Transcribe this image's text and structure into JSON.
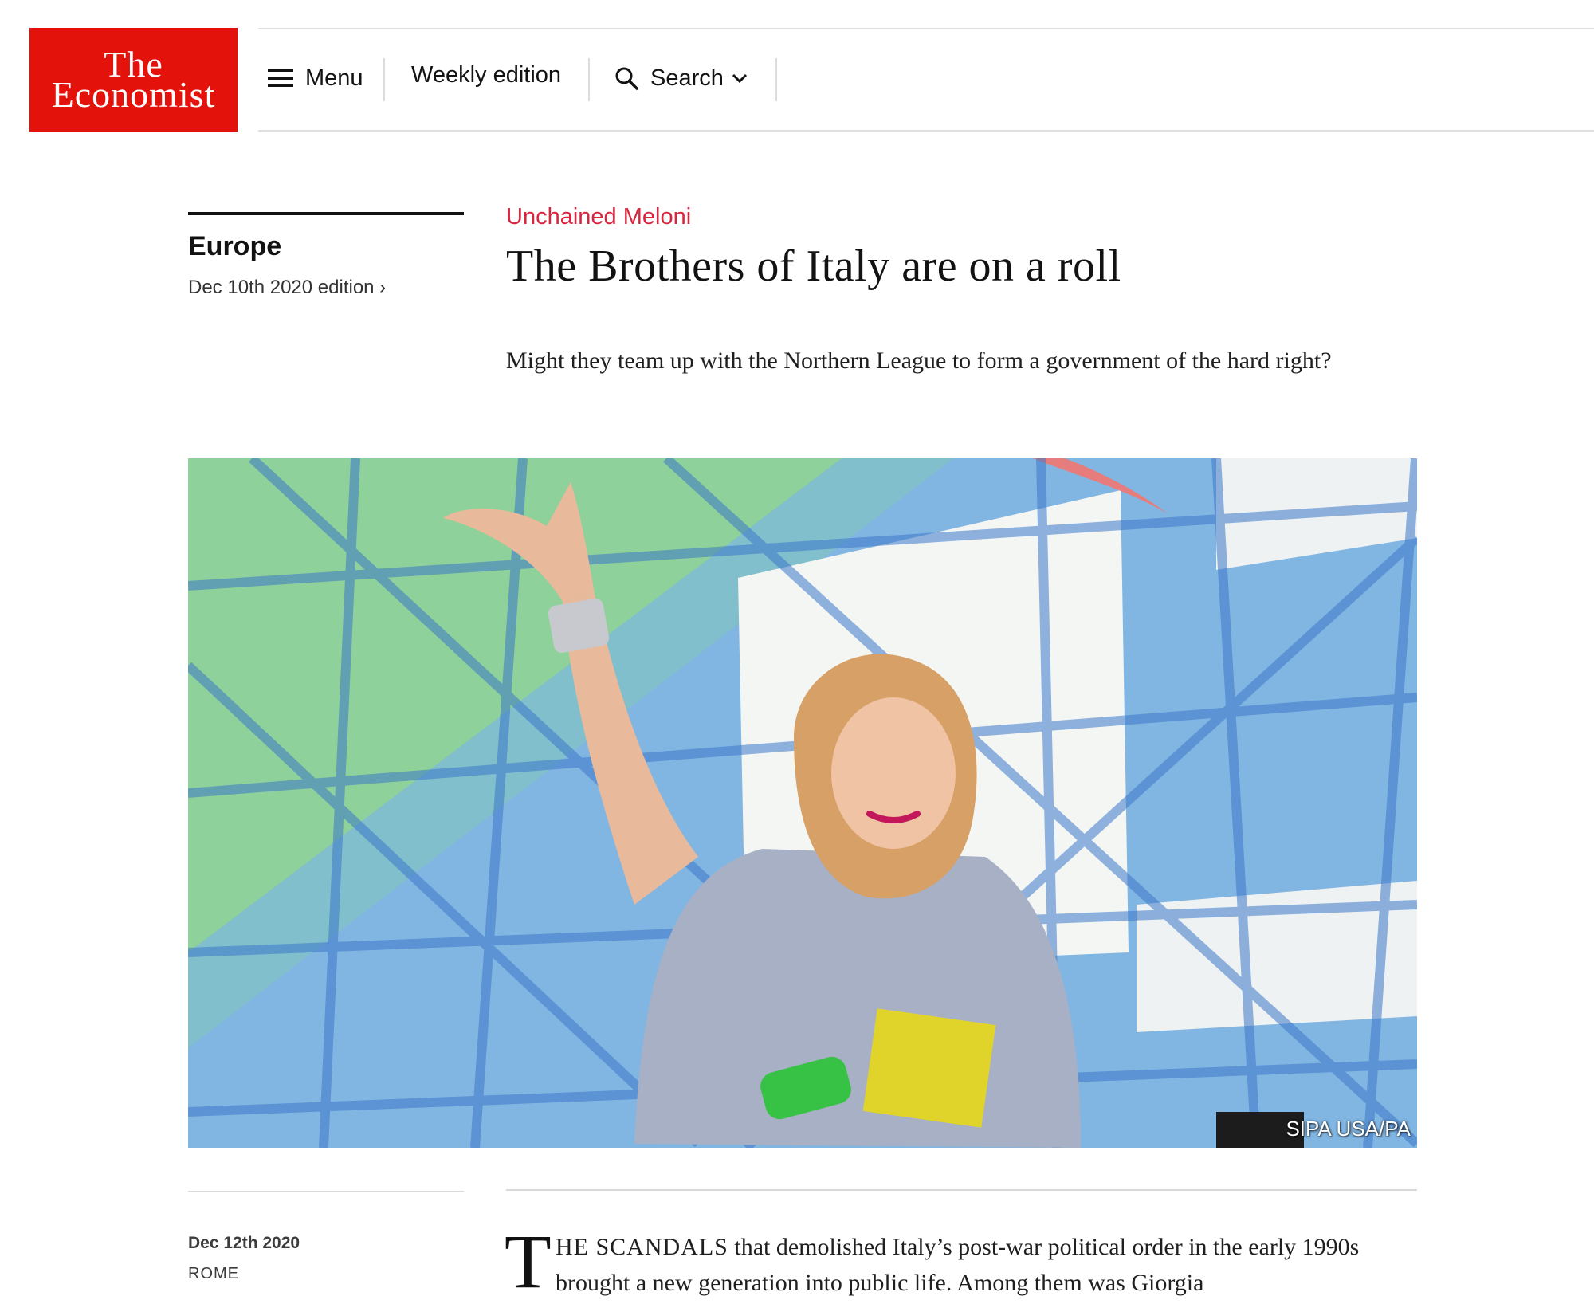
{
  "header": {
    "logo_line1": "The",
    "logo_line2": "Economist",
    "menu_label": "Menu",
    "weekly_label": "Weekly edition",
    "search_label": "Search"
  },
  "article": {
    "section": "Europe",
    "edition": "Dec 10th 2020 edition ›",
    "rubric": "Unchained Meloni",
    "headline": "The Brothers of Italy are on a roll",
    "subheadline": "Might they team up with the Northern League to form a government of the hard right?",
    "image_credit": "SIPA USA/PA",
    "date": "Dec 12th 2020",
    "location": "ROME",
    "dropcap": "T",
    "lead_smallcaps": "HE SCANDALS",
    "lead_text": " that demolished Italy’s post-war political order in the early 1990s brought a new generation into public life. Among them was Giorgia"
  },
  "colors": {
    "brand_red": "#e3120b",
    "rubric_red": "#d7263d"
  },
  "icons": [
    "hamburger-icon",
    "search-icon",
    "chevron-down-icon"
  ]
}
